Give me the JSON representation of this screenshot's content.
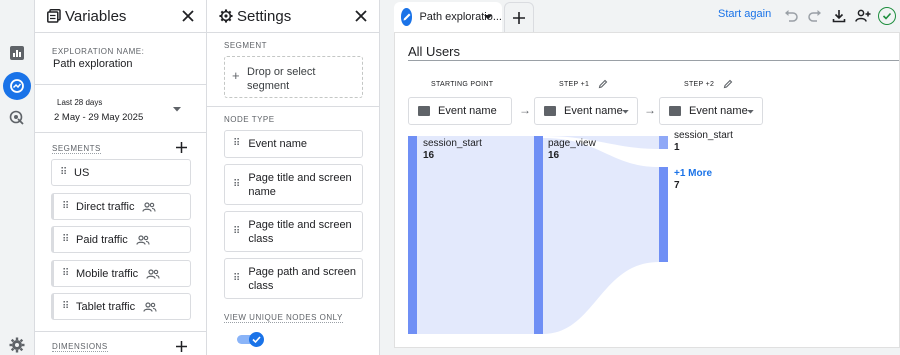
{
  "variables": {
    "title": "Variables",
    "exploration_name_label": "EXPLORATION NAME:",
    "exploration_name": "Path exploration",
    "date_range_label": "Last 28 days",
    "date_range_value": "2 May - 29 May 2025",
    "segments_label": "SEGMENTS",
    "segments": [
      {
        "label": "US",
        "has_people_icon": false
      },
      {
        "label": "Direct traffic",
        "has_people_icon": true
      },
      {
        "label": "Paid traffic",
        "has_people_icon": true
      },
      {
        "label": "Mobile traffic",
        "has_people_icon": true
      },
      {
        "label": "Tablet traffic",
        "has_people_icon": true
      }
    ],
    "dimensions_label": "DIMENSIONS"
  },
  "settings": {
    "title": "Settings",
    "segment_label": "SEGMENT",
    "drop_segment": "Drop or select segment",
    "node_type_label": "NODE TYPE",
    "node_types": [
      "Event name",
      "Page title and screen name",
      "Page title and screen class",
      "Page path and screen class"
    ],
    "unique_nodes_label": "VIEW UNIQUE NODES ONLY",
    "unique_nodes_enabled": true
  },
  "tab": {
    "label": "Path exploratio...",
    "start_again": "Start again"
  },
  "canvas": {
    "segment_title": "All Users",
    "columns": [
      {
        "header": "STARTING POINT",
        "dropdown": "Event name"
      },
      {
        "header": "STEP +1",
        "dropdown": "Event name"
      },
      {
        "header": "STEP +2",
        "dropdown": "Event name"
      }
    ],
    "nodes": {
      "start": {
        "label": "session_start",
        "value": "16"
      },
      "step1": {
        "label": "page_view",
        "value": "16"
      },
      "step2a": {
        "label": "session_start",
        "value": "1"
      },
      "step2b": {
        "label": "+1 More",
        "value": "7"
      }
    }
  },
  "colors": {
    "accent": "#1a73e8",
    "node_bar": "#6f8ff5",
    "flow": "#e3e9fc",
    "check": "#1e8e3e"
  }
}
